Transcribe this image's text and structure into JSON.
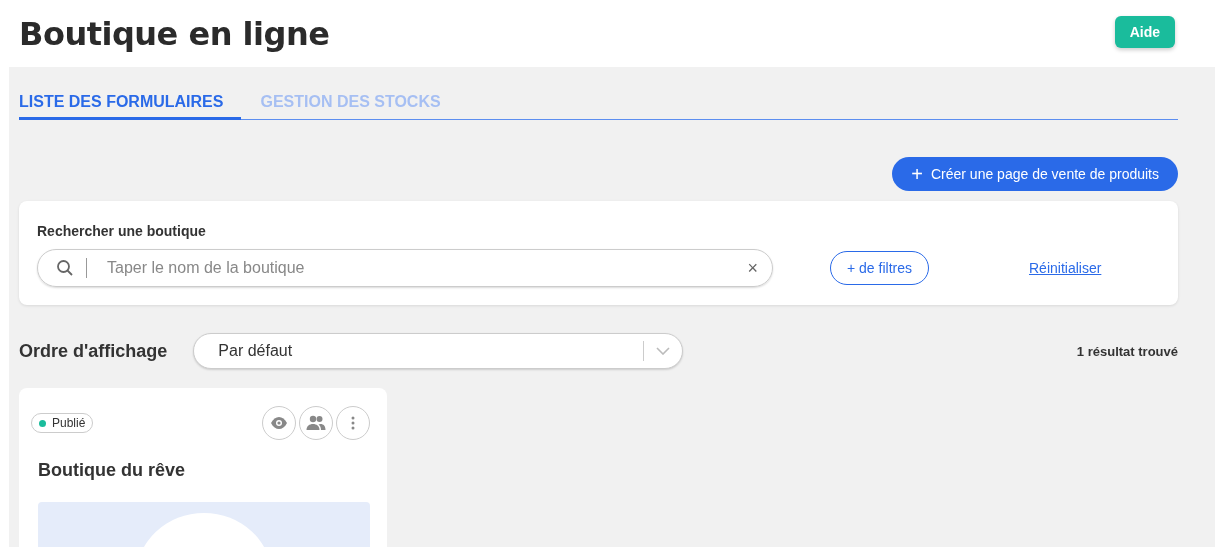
{
  "header": {
    "title": "Boutique en ligne",
    "help_button": "Aide"
  },
  "tabs": [
    {
      "label": "LISTE DES FORMULAIRES",
      "selected": true
    },
    {
      "label": "GESTION DES STOCKS",
      "selected": false
    }
  ],
  "create_button": {
    "icon": "+",
    "label": "Créer une page de vente de produits"
  },
  "search": {
    "label": "Rechercher une boutique",
    "placeholder": "Taper le nom de la boutique",
    "clear": "×",
    "filters_button": "+ de filtres",
    "reset_link": "Réinitialiser"
  },
  "sort": {
    "label": "Ordre d'affichage",
    "value": "Par défaut"
  },
  "result_count": "1 résultat trouvé",
  "cards": [
    {
      "status": "Publié",
      "color": "#1abc9c",
      "title": "Boutique du rêve"
    }
  ]
}
